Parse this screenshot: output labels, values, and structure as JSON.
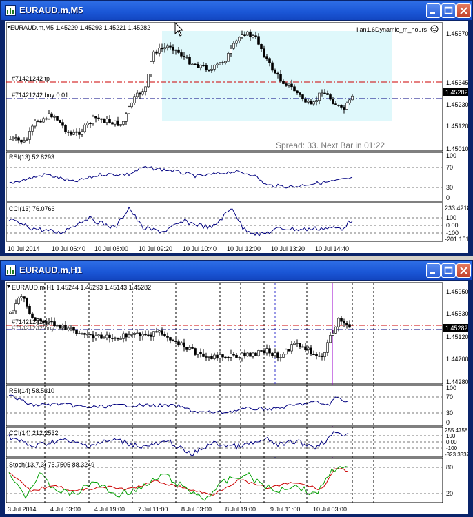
{
  "window_m5": {
    "title": "EURAUD.m,M5",
    "symbol_line": "EURAUD.m,M5  1.45229 1.45293 1.45221 1.45282",
    "indicator_name": "Ilan1.6Dynamic_m_hours",
    "tp_label": "#71421242 tp",
    "buy_label": "#71421242 buy 0.01",
    "price_axis": [
      "1.45570",
      "1.45345",
      "1.45230",
      "1.45120",
      "1.45010"
    ],
    "current_price": "1.45282",
    "spread_text": "Spread: 33. Next Bar in 01:22",
    "rsi": {
      "label": "RSI(13) 52.8293",
      "levels": [
        "70",
        "30",
        "0"
      ],
      "top": "100"
    },
    "cci": {
      "label": "CCI(13) 76.0766",
      "levels": [
        "233.4218",
        "100",
        "0.00",
        "-100",
        "-201.151"
      ]
    },
    "time_axis": [
      "10 Jul 2014",
      "10 Jul 06:40",
      "10 Jul 08:00",
      "10 Jul 09:20",
      "10 Jul 10:40",
      "10 Jul 12:00",
      "10 Jul 13:20",
      "10 Jul 14:40"
    ]
  },
  "window_h1": {
    "title": "EURAUD.m,H1",
    "symbol_line": "EURAUD.m,H1  1.45244 1.45293 1.45143 1.45282",
    "tp_label": "#71421242 tp",
    "buy_label": "#71421242 buy 0.01",
    "price_axis": [
      "1.45950",
      "1.45530",
      "1.45120",
      "1.44700",
      "1.44280"
    ],
    "current_price": "1.45282",
    "rsi": {
      "label": "RSI(14) 58.5310",
      "levels": [
        "70",
        "30",
        "0"
      ],
      "top": "100"
    },
    "cci": {
      "label": "CCI(14) 212.2532",
      "levels": [
        "255.4758",
        "100",
        "0.00",
        "-100",
        "-323.3337"
      ]
    },
    "stoch": {
      "label": "Stoch(13,7,3) 75.7505 88.3249",
      "levels": [
        "80",
        "20"
      ]
    },
    "time_axis": [
      "3 Jul 2014",
      "4 Jul 03:00",
      "4 Jul 19:00",
      "7 Jul 11:00",
      "8 Jul 03:00",
      "8 Jul 19:00",
      "9 Jul 11:00",
      "10 Jul 03:00"
    ]
  },
  "colors": {
    "highlight": "#dff8fb",
    "tp_line": "#cc0000",
    "buy_line": "#000080",
    "indicator_line": "#000080",
    "stoch_main": "#00a000",
    "stoch_signal": "#cc0000",
    "vline_purple": "#9900cc"
  },
  "icons": [
    "chart-window-icon",
    "minimize-icon",
    "maximize-icon",
    "close-icon",
    "smiley-icon",
    "cursor-arrow-icon"
  ]
}
